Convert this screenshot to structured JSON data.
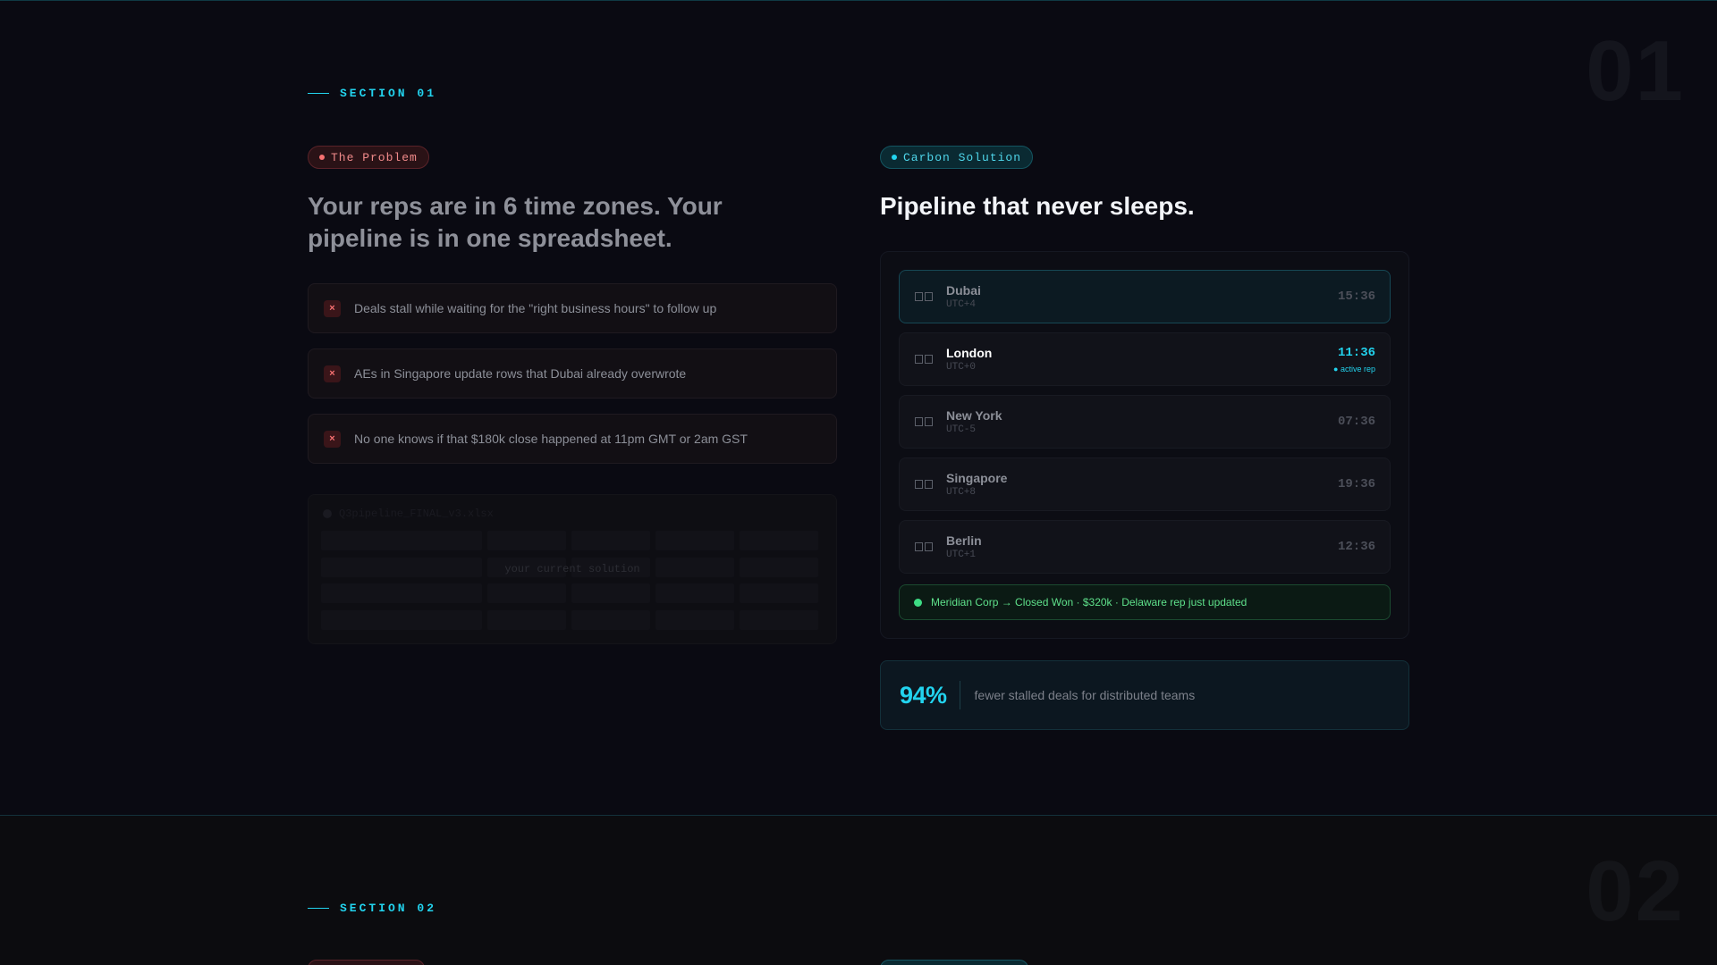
{
  "section1": {
    "number": "01",
    "label": "SECTION 01",
    "problem": {
      "tag": "The Problem",
      "title": "Your reps are in 6 time zones. Your pipeline is in one spreadsheet.",
      "items": [
        "Deals stall while waiting for the \"right business hours\" to follow up",
        "AEs in Singapore update rows that Dubai already overwrote",
        "No one knows if that $180k close happened at 11pm GMT or 2am GST"
      ],
      "x_glyph": "×",
      "faded_header": "Q3pipeline_FINAL_v3.xlsx",
      "faded_caption": "your current solution"
    },
    "solution": {
      "tag": "Carbon Solution",
      "title": "Pipeline that never sleeps.",
      "timezones": [
        {
          "city": "Dubai",
          "utc": "UTC+4",
          "time": "15:36"
        },
        {
          "city": "London",
          "utc": "UTC+0",
          "time": "11:36",
          "status": "● active rep"
        },
        {
          "city": "New York",
          "utc": "UTC-5",
          "time": "07:36"
        },
        {
          "city": "Singapore",
          "utc": "UTC+8",
          "time": "19:36"
        },
        {
          "city": "Berlin",
          "utc": "UTC+1",
          "time": "12:36"
        }
      ],
      "notification": "Meridian Corp → Closed Won · $320k · Delaware rep just updated",
      "stat": {
        "value": "94%",
        "description": "fewer stalled deals for distributed teams"
      }
    }
  },
  "section2": {
    "number": "02",
    "label": "SECTION 02"
  }
}
